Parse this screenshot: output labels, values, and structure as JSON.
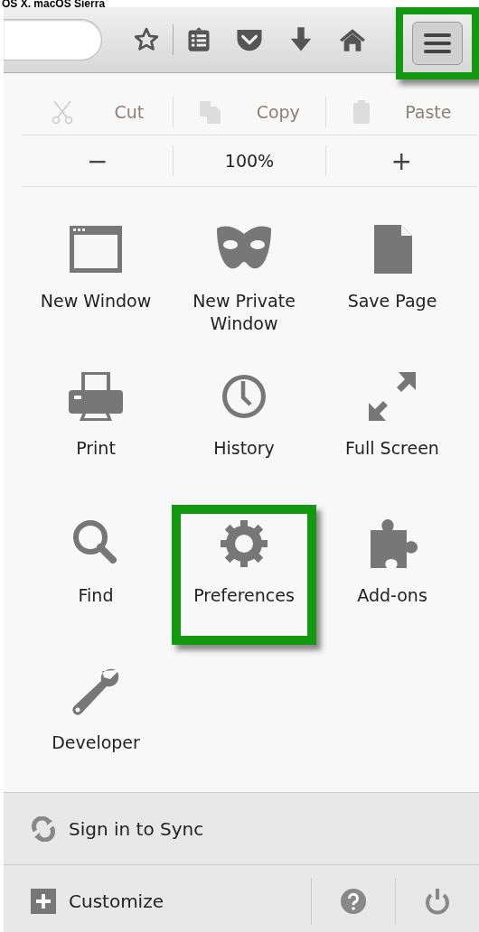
{
  "caption": "OS X, macOS Sierra",
  "toolbar": {
    "menu_button": {
      "highlighted": true
    }
  },
  "edit_row": [
    {
      "label": "Cut",
      "disabled": true
    },
    {
      "label": "Copy",
      "disabled": true
    },
    {
      "label": "Paste",
      "disabled": true
    }
  ],
  "zoom_row": {
    "minus": "−",
    "level": "100%",
    "plus": "+"
  },
  "items": [
    {
      "label": "New Window",
      "highlighted": false
    },
    {
      "label": "New Private Window",
      "highlighted": false
    },
    {
      "label": "Save Page",
      "highlighted": false
    },
    {
      "label": "Print",
      "highlighted": false
    },
    {
      "label": "History",
      "highlighted": false
    },
    {
      "label": "Full Screen",
      "highlighted": false
    },
    {
      "label": "Find",
      "highlighted": false
    },
    {
      "label": "Preferences",
      "highlighted": true
    },
    {
      "label": "Add-ons",
      "highlighted": false
    },
    {
      "label": "Developer",
      "highlighted": false
    }
  ],
  "sync": {
    "label": "Sign in to Sync"
  },
  "footer": {
    "customize": "Customize"
  }
}
